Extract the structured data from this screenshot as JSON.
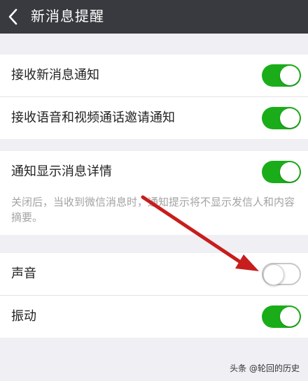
{
  "header": {
    "title": "新消息提醒"
  },
  "group1": {
    "rows": [
      {
        "label": "接收新消息通知",
        "on": true
      },
      {
        "label": "接收语音和视频通话邀请通知",
        "on": true
      }
    ]
  },
  "group2": {
    "row": {
      "label": "通知显示消息详情",
      "on": true
    },
    "description": "关闭后，当收到微信消息时，通知提示将不显示发信人和内容摘要。"
  },
  "group3": {
    "rows": [
      {
        "label": "声音",
        "on": false
      },
      {
        "label": "振动",
        "on": true
      }
    ]
  },
  "watermark": "头条 @轮回的历史",
  "colors": {
    "toggle_on": "#1aad19",
    "toggle_off": "#c7c7c7",
    "header_bg": "#393a3f",
    "arrow": "#c81d1d"
  },
  "icons": {
    "back": "chevron-left-icon"
  }
}
